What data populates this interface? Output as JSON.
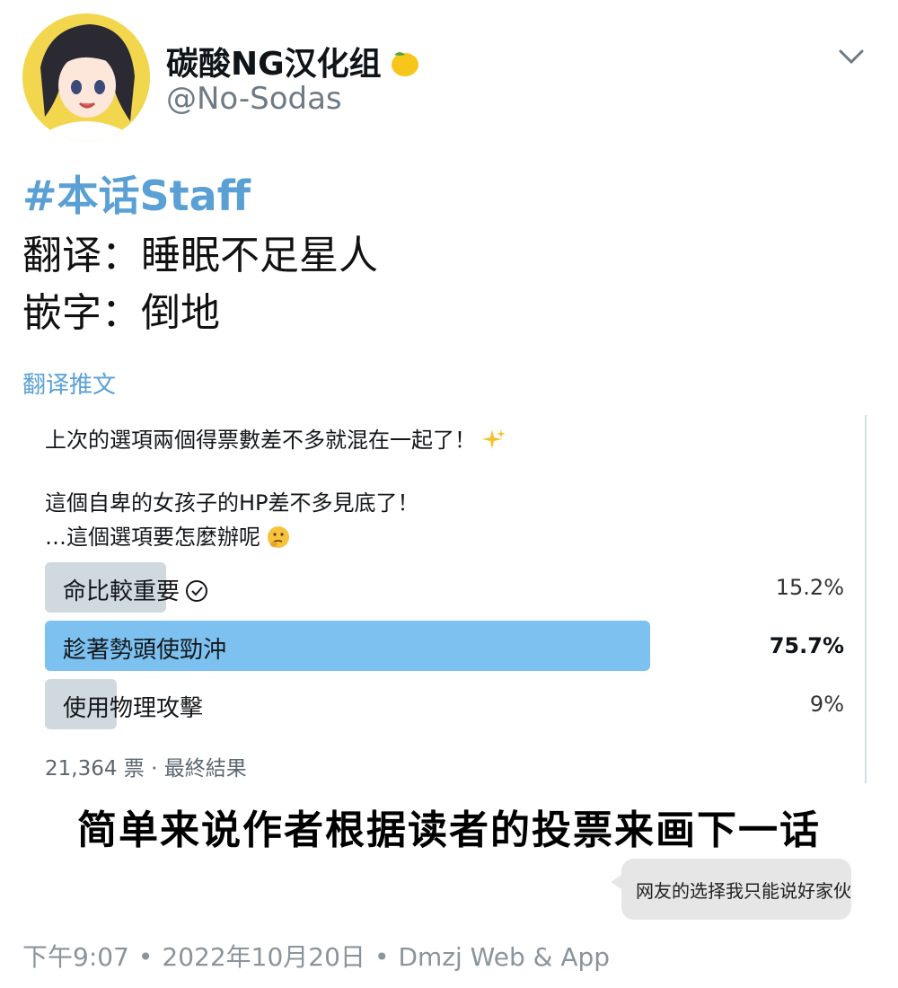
{
  "profile": {
    "display_name": "碳酸NG汉化组",
    "handle": "@No-Sodas",
    "avatar_icon": "anime-girl-avatar",
    "badge_icon": "lemon-emoji-icon"
  },
  "tweet": {
    "hashtag": "#本话Staff",
    "credit_translation": "翻译：睡眠不足星人",
    "credit_typeset": "嵌字：倒地",
    "translate_link": "翻译推文"
  },
  "poll": {
    "text_1": "上次的選項兩個得票數差不多就混在一起了！",
    "text_2": "這個自卑的女孩子的HP差不多見底了！",
    "text_3": "…這個選項要怎麼辦呢",
    "options": [
      {
        "label": "命比較重要",
        "percent": "15.2%",
        "fraction": 0.152,
        "voted": true
      },
      {
        "label": "趁著勢頭使勁沖",
        "percent": "75.7%",
        "fraction": 0.757,
        "winner": true
      },
      {
        "label": "使用物理攻擊",
        "percent": "9%",
        "fraction": 0.09
      }
    ],
    "footer": "21,364 票 · 最終結果",
    "colors": {
      "winner": "#7cc1f0",
      "other": "#cfd9de"
    }
  },
  "caption": "简单来说作者根据读者的投票来画下一话",
  "bubble": "网友的选择我只能说好家伙",
  "timestamp": {
    "time": "下午9:07",
    "date": "2022年10月20日",
    "source": "Dmzj Web & App"
  },
  "colors": {
    "link": "#5aa0d4",
    "muted": "#6e7a84"
  }
}
